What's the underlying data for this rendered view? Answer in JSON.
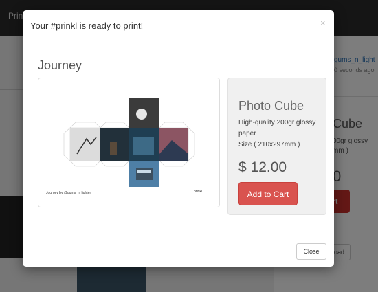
{
  "background": {
    "brand_text": "Prin",
    "user_link": "gums_n_light",
    "time_text": "0 seconds ago",
    "product_name": "Cube",
    "desc_text": "00gr glossy\nmm )",
    "price_text": "0",
    "cart_text": "rt",
    "download_text": "load"
  },
  "modal": {
    "title": "Your #prinkl is ready to print!",
    "close_symbol": "×"
  },
  "preview": {
    "title": "Journey",
    "caption": "Journey by @gums_n_lighter",
    "logo_text": "prinkl"
  },
  "product": {
    "name": "Photo Cube",
    "description": "High-quality 200gr glossy paper",
    "size": "Size ( 210x297mm )",
    "price": "$ 12.00",
    "add_to_cart_label": "Add to Cart"
  },
  "footer": {
    "close_label": "Close"
  },
  "colors": {
    "accent_red": "#d9534f",
    "topbar": "#2b2b2b",
    "link_blue": "#2a6fb2"
  }
}
